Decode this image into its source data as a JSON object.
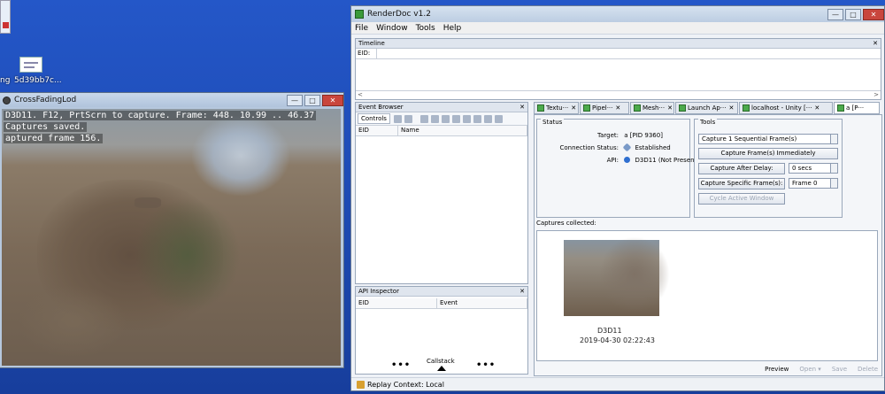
{
  "desktop": {
    "icon_label_1": "ng",
    "icon_label_2": "5d39bb7c..."
  },
  "game_window": {
    "title": "CrossFadingLod",
    "controls": {
      "minimize": "—",
      "maximize": "□",
      "close": "✕"
    },
    "hud": {
      "line1": "D3D11. F12, PrtScrn to capture. Frame: 448.          10.99 .. 46.37",
      "line2": " Captures saved.",
      "line3": "aptured frame 156."
    }
  },
  "renderdoc": {
    "title": "RenderDoc v1.2",
    "controls": {
      "minimize": "—",
      "maximize": "□",
      "close": "✕"
    },
    "menu": [
      "File",
      "Window",
      "Tools",
      "Help"
    ],
    "timeline": {
      "title": "Timeline",
      "eid_label": "EID:",
      "close": "✕",
      "left_arrow": "<",
      "right_arrow": ">"
    },
    "event_browser": {
      "title": "Event Browser",
      "close": "✕",
      "controls_tab": "Controls",
      "columns": [
        "EID",
        "Name"
      ]
    },
    "api_inspector": {
      "title": "API Inspector",
      "close": "✕",
      "columns": [
        "EID",
        "Event"
      ],
      "callstack_label": "Callstack",
      "dots_left": "•••",
      "dots_right": "•••"
    },
    "tabs": [
      {
        "label": "Textu···",
        "close": "✕"
      },
      {
        "label": "Pipel···",
        "close": "✕"
      },
      {
        "label": "Mesh···",
        "close": "✕"
      },
      {
        "label": "Launch Ap···",
        "close": "✕"
      },
      {
        "label": "localhost - Unity [···",
        "close": "✕"
      },
      {
        "label": "a [P···",
        "close": ""
      }
    ],
    "status_group": {
      "title": "Status",
      "target_label": "Target:",
      "target_value": "a [PID 9360]",
      "connection_label": "Connection Status:",
      "connection_value": "Established",
      "api_label": "API:",
      "api_value": "D3D11 (Not Presenting)"
    },
    "tools_group": {
      "title": "Tools",
      "sequential_field": "Capture 1 Sequential Frame(s)",
      "capture_immediately": "Capture Frame(s) Immediately",
      "capture_after_delay": "Capture After Delay:",
      "delay_value": "0 secs",
      "capture_specific": "Capture Specific Frame(s):",
      "specific_value": "Frame 0",
      "cycle_window": "Cycle Active Window"
    },
    "captures": {
      "label": "Captures collected:",
      "items": [
        {
          "api": "D3D11",
          "timestamp": "2019-04-30 02:22:43"
        }
      ]
    },
    "capture_actions": {
      "preview": "Preview",
      "open": "Open ▾",
      "save": "Save",
      "delete": "Delete"
    },
    "statusbar": {
      "text": "Replay Context: Local"
    }
  }
}
